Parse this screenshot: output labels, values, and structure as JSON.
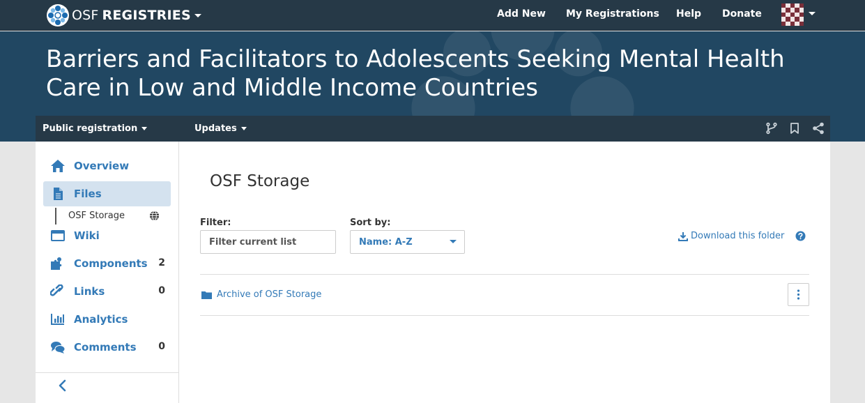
{
  "topnav": {
    "brand_osf": "OSF",
    "brand_product": "REGISTRIES",
    "links": [
      "Add New",
      "My Registrations",
      "Help",
      "Donate"
    ],
    "icons": {
      "logo": "osf-logo-icon",
      "avatar": "user-avatar"
    }
  },
  "hero": {
    "title": "Barriers and Facilitators to Adolescents Seeking Mental Health Care in Low and Middle Income Countries"
  },
  "subnav": {
    "registration_label": "Public registration",
    "updates_label": "Updates",
    "icons": [
      "fork-icon",
      "bookmark-icon",
      "share-icon"
    ]
  },
  "sidebar": {
    "items": [
      {
        "label": "Overview",
        "icon": "home-icon",
        "count": ""
      },
      {
        "label": "Files",
        "icon": "file-icon",
        "count": "",
        "active": true
      },
      {
        "label": "Wiki",
        "icon": "wiki-icon",
        "count": ""
      },
      {
        "label": "Components",
        "icon": "puzzle-icon",
        "count": "2"
      },
      {
        "label": "Links",
        "icon": "link-icon",
        "count": "0"
      },
      {
        "label": "Analytics",
        "icon": "bar-chart-icon",
        "count": ""
      },
      {
        "label": "Comments",
        "icon": "comments-icon",
        "count": "0"
      }
    ],
    "sub_item": {
      "label": "OSF Storage",
      "icon": "globe-icon"
    }
  },
  "content": {
    "title": "OSF Storage",
    "filter_label": "Filter:",
    "filter_placeholder": "Filter current list",
    "sort_label": "Sort by:",
    "sort_value": "Name: A-Z",
    "download_label": "Download this folder",
    "files": [
      {
        "name": "Archive of OSF Storage",
        "icon": "folder-icon"
      }
    ]
  },
  "colors": {
    "topnav_bg": "#263947",
    "hero_bg": "#214762",
    "link": "#337ab7",
    "active_item_bg": "#d4e2ef"
  }
}
